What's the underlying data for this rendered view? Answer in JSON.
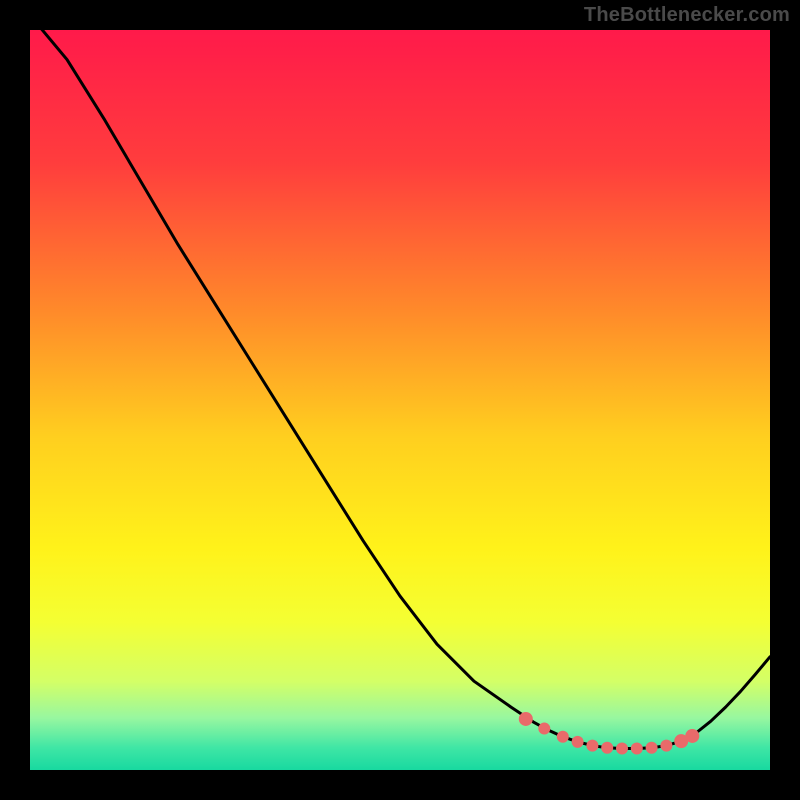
{
  "attribution": "TheBottlenecker.com",
  "chart_data": {
    "type": "line",
    "title": "",
    "xlabel": "",
    "ylabel": "",
    "xlim": [
      0,
      100
    ],
    "ylim": [
      0,
      100
    ],
    "series": [
      {
        "name": "curve",
        "x": [
          0,
          5,
          10,
          15,
          20,
          25,
          30,
          35,
          40,
          45,
          50,
          55,
          60,
          65,
          68,
          70,
          72,
          74,
          76,
          78,
          80,
          82,
          84,
          86,
          88,
          90,
          92,
          94,
          96,
          98,
          100
        ],
        "values": [
          102,
          96,
          88,
          79.5,
          71,
          63,
          55,
          47,
          39,
          31,
          23.5,
          17,
          12,
          8.5,
          6.5,
          5.4,
          4.5,
          3.8,
          3.3,
          3.0,
          2.9,
          2.9,
          3.0,
          3.3,
          3.9,
          5.0,
          6.6,
          8.5,
          10.6,
          12.9,
          15.3
        ]
      }
    ],
    "markers": {
      "name": "highlight-dots",
      "x": [
        67,
        69.5,
        72,
        74,
        76,
        78,
        80,
        82,
        84,
        86,
        88,
        89.5
      ],
      "values": [
        6.9,
        5.6,
        4.5,
        3.8,
        3.3,
        3.0,
        2.9,
        2.9,
        3.0,
        3.3,
        3.9,
        4.6
      ]
    },
    "gradient": {
      "stops": [
        {
          "offset": 0.0,
          "color": "#ff1a4a"
        },
        {
          "offset": 0.18,
          "color": "#ff3d3d"
        },
        {
          "offset": 0.38,
          "color": "#ff8a2a"
        },
        {
          "offset": 0.55,
          "color": "#ffcf1f"
        },
        {
          "offset": 0.7,
          "color": "#fff21a"
        },
        {
          "offset": 0.8,
          "color": "#f4ff33"
        },
        {
          "offset": 0.88,
          "color": "#d4ff66"
        },
        {
          "offset": 0.93,
          "color": "#97f7a0"
        },
        {
          "offset": 0.97,
          "color": "#3fe6a5"
        },
        {
          "offset": 1.0,
          "color": "#18d9a0"
        }
      ]
    },
    "marker_color": "#e96a6a",
    "curve_color": "#000000"
  }
}
